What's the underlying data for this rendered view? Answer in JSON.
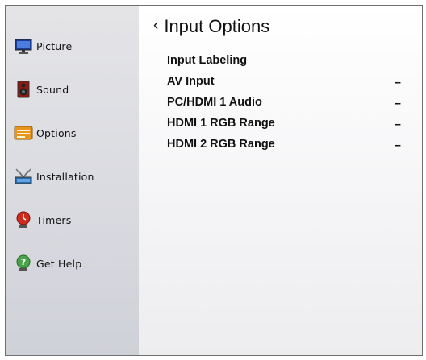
{
  "sidebar": {
    "items": [
      {
        "label": "Picture",
        "icon": "monitor-icon"
      },
      {
        "label": "Sound",
        "icon": "speaker-icon"
      },
      {
        "label": "Options",
        "icon": "options-icon"
      },
      {
        "label": "Installation",
        "icon": "antenna-icon"
      },
      {
        "label": "Timers",
        "icon": "timer-icon"
      },
      {
        "label": "Get Help",
        "icon": "help-icon"
      }
    ]
  },
  "main": {
    "back_glyph": "‹",
    "title": "Input Options",
    "options": [
      {
        "label": "Input Labeling",
        "value": ""
      },
      {
        "label": "AV Input",
        "value": "--"
      },
      {
        "label": "PC/HDMI 1 Audio",
        "value": "--"
      },
      {
        "label": "HDMI 1 RGB Range",
        "value": "--"
      },
      {
        "label": "HDMI 2 RGB Range",
        "value": "--"
      }
    ]
  }
}
